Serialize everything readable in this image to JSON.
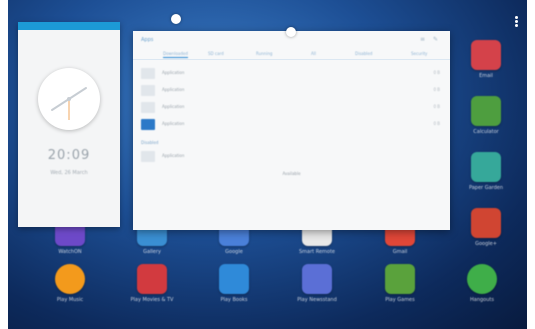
{
  "background": {
    "primary": "#1d4f95",
    "accent": "#3d7fc9"
  },
  "apps_right": [
    {
      "label": "Email",
      "color": "#d4424a"
    },
    {
      "label": "Calculator",
      "color": "#4e9e3f"
    },
    {
      "label": "Paper Garden",
      "color": "#36a89a"
    },
    {
      "label": "Google+",
      "color": "#d04532"
    }
  ],
  "apps_row_1": [
    {
      "label": "WatchON",
      "color": "#6d49c8"
    },
    {
      "label": "Gallery",
      "color": "#3a8fd3"
    },
    {
      "label": "Google",
      "color": "#4a80d9"
    },
    {
      "label": "Smart Remote",
      "color": "#e8e8e8"
    },
    {
      "label": "Gmail",
      "color": "#e04738"
    }
  ],
  "apps_row_2": [
    {
      "label": "Play Music",
      "color": "#f39a1c"
    },
    {
      "label": "Play Movies & TV",
      "color": "#d23a3f"
    },
    {
      "label": "Play Books",
      "color": "#2f8ad9"
    },
    {
      "label": "Play Newsstand",
      "color": "#5b6fd6"
    },
    {
      "label": "Play Games",
      "color": "#5aa23c"
    },
    {
      "label": "Hangouts",
      "color": "#3fae49"
    }
  ],
  "clock": {
    "time": "20:09",
    "date": "Wed, 26 March",
    "accent": "#1c9ad6"
  },
  "settings": {
    "title": "Apps",
    "toolbar_icons": "≡ ✎",
    "tabs": [
      "Downloaded",
      "SD card",
      "Running",
      "All",
      "Disabled",
      "Security"
    ],
    "rows": [
      {
        "name": "Application",
        "size": "0 B"
      },
      {
        "name": "Application",
        "size": "0 B"
      },
      {
        "name": "Application",
        "size": "0 B"
      },
      {
        "name": "Application",
        "size": "0 B"
      }
    ],
    "section": "Disabled",
    "section_row": "Application",
    "footer": "Available"
  }
}
